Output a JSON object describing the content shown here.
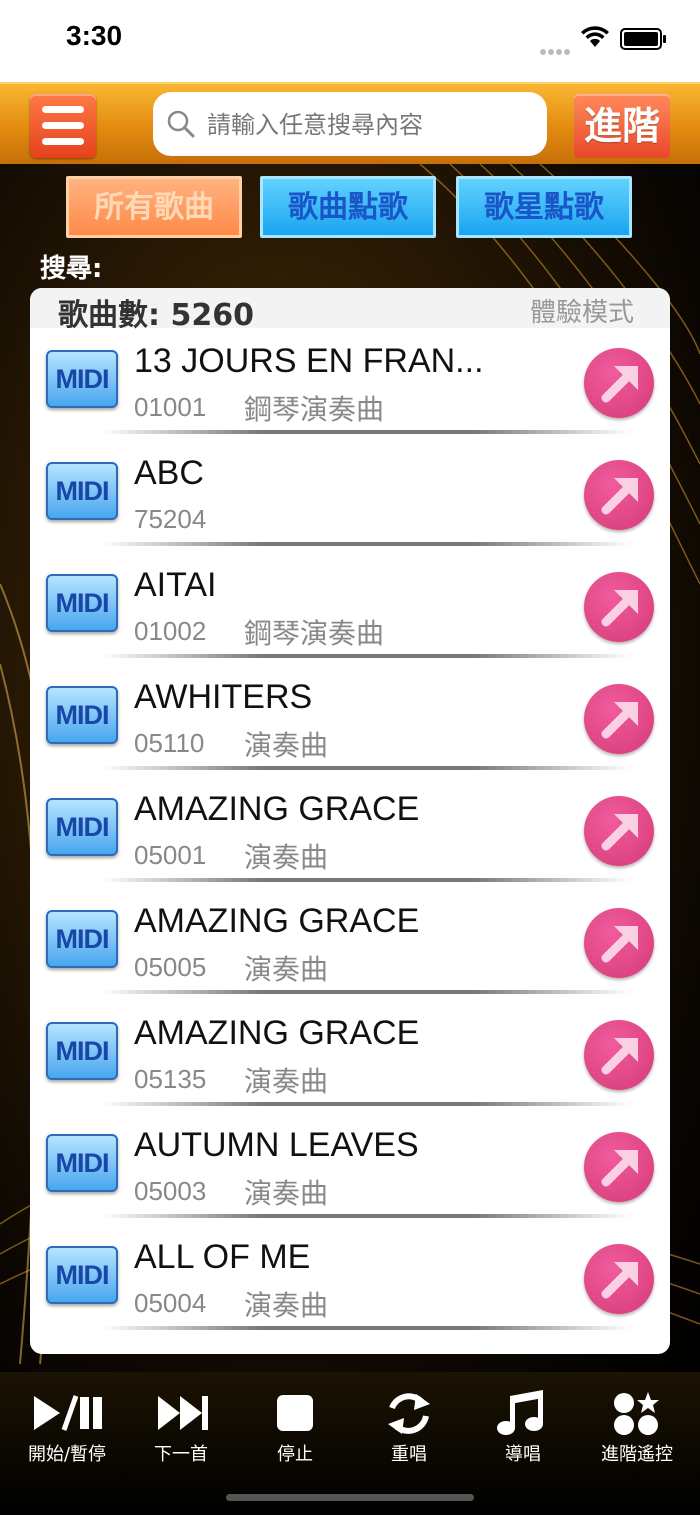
{
  "status_bar": {
    "time": "3:30"
  },
  "header": {
    "search_placeholder": "請輸入任意搜尋內容",
    "advanced_label": "進階"
  },
  "categories": [
    {
      "label": "所有歌曲"
    },
    {
      "label": "歌曲點歌"
    },
    {
      "label": "歌星點歌"
    }
  ],
  "search_label": "搜尋:",
  "list_header": {
    "count_label": "歌曲數: 5260",
    "mode_label": "體驗模式"
  },
  "songs": [
    {
      "badge": "MIDI",
      "title": "13 JOURS EN FRAN...",
      "id": "01001",
      "type": "鋼琴演奏曲"
    },
    {
      "badge": "MIDI",
      "title": "ABC",
      "id": "75204",
      "type": ""
    },
    {
      "badge": "MIDI",
      "title": "AITAI",
      "id": "01002",
      "type": "鋼琴演奏曲"
    },
    {
      "badge": "MIDI",
      "title": "AWHITERS",
      "id": "05110",
      "type": "演奏曲"
    },
    {
      "badge": "MIDI",
      "title": "AMAZING GRACE",
      "id": "05001",
      "type": "演奏曲"
    },
    {
      "badge": "MIDI",
      "title": "AMAZING GRACE",
      "id": "05005",
      "type": "演奏曲"
    },
    {
      "badge": "MIDI",
      "title": "AMAZING GRACE",
      "id": "05135",
      "type": "演奏曲"
    },
    {
      "badge": "MIDI",
      "title": "AUTUMN LEAVES",
      "id": "05003",
      "type": "演奏曲"
    },
    {
      "badge": "MIDI",
      "title": "ALL OF ME",
      "id": "05004",
      "type": "演奏曲"
    }
  ],
  "toolbar": [
    {
      "label": "開始/暫停",
      "icon": "play-pause-icon"
    },
    {
      "label": "下一首",
      "icon": "next-track-icon"
    },
    {
      "label": "停止",
      "icon": "stop-icon"
    },
    {
      "label": "重唱",
      "icon": "replay-icon"
    },
    {
      "label": "導唱",
      "icon": "music-note-icon"
    },
    {
      "label": "進階遙控",
      "icon": "advanced-remote-icon"
    }
  ],
  "colors": {
    "header_orange": "#e38b10",
    "pink_button": "#e04485",
    "blue_tab": "#1aa4f0"
  }
}
